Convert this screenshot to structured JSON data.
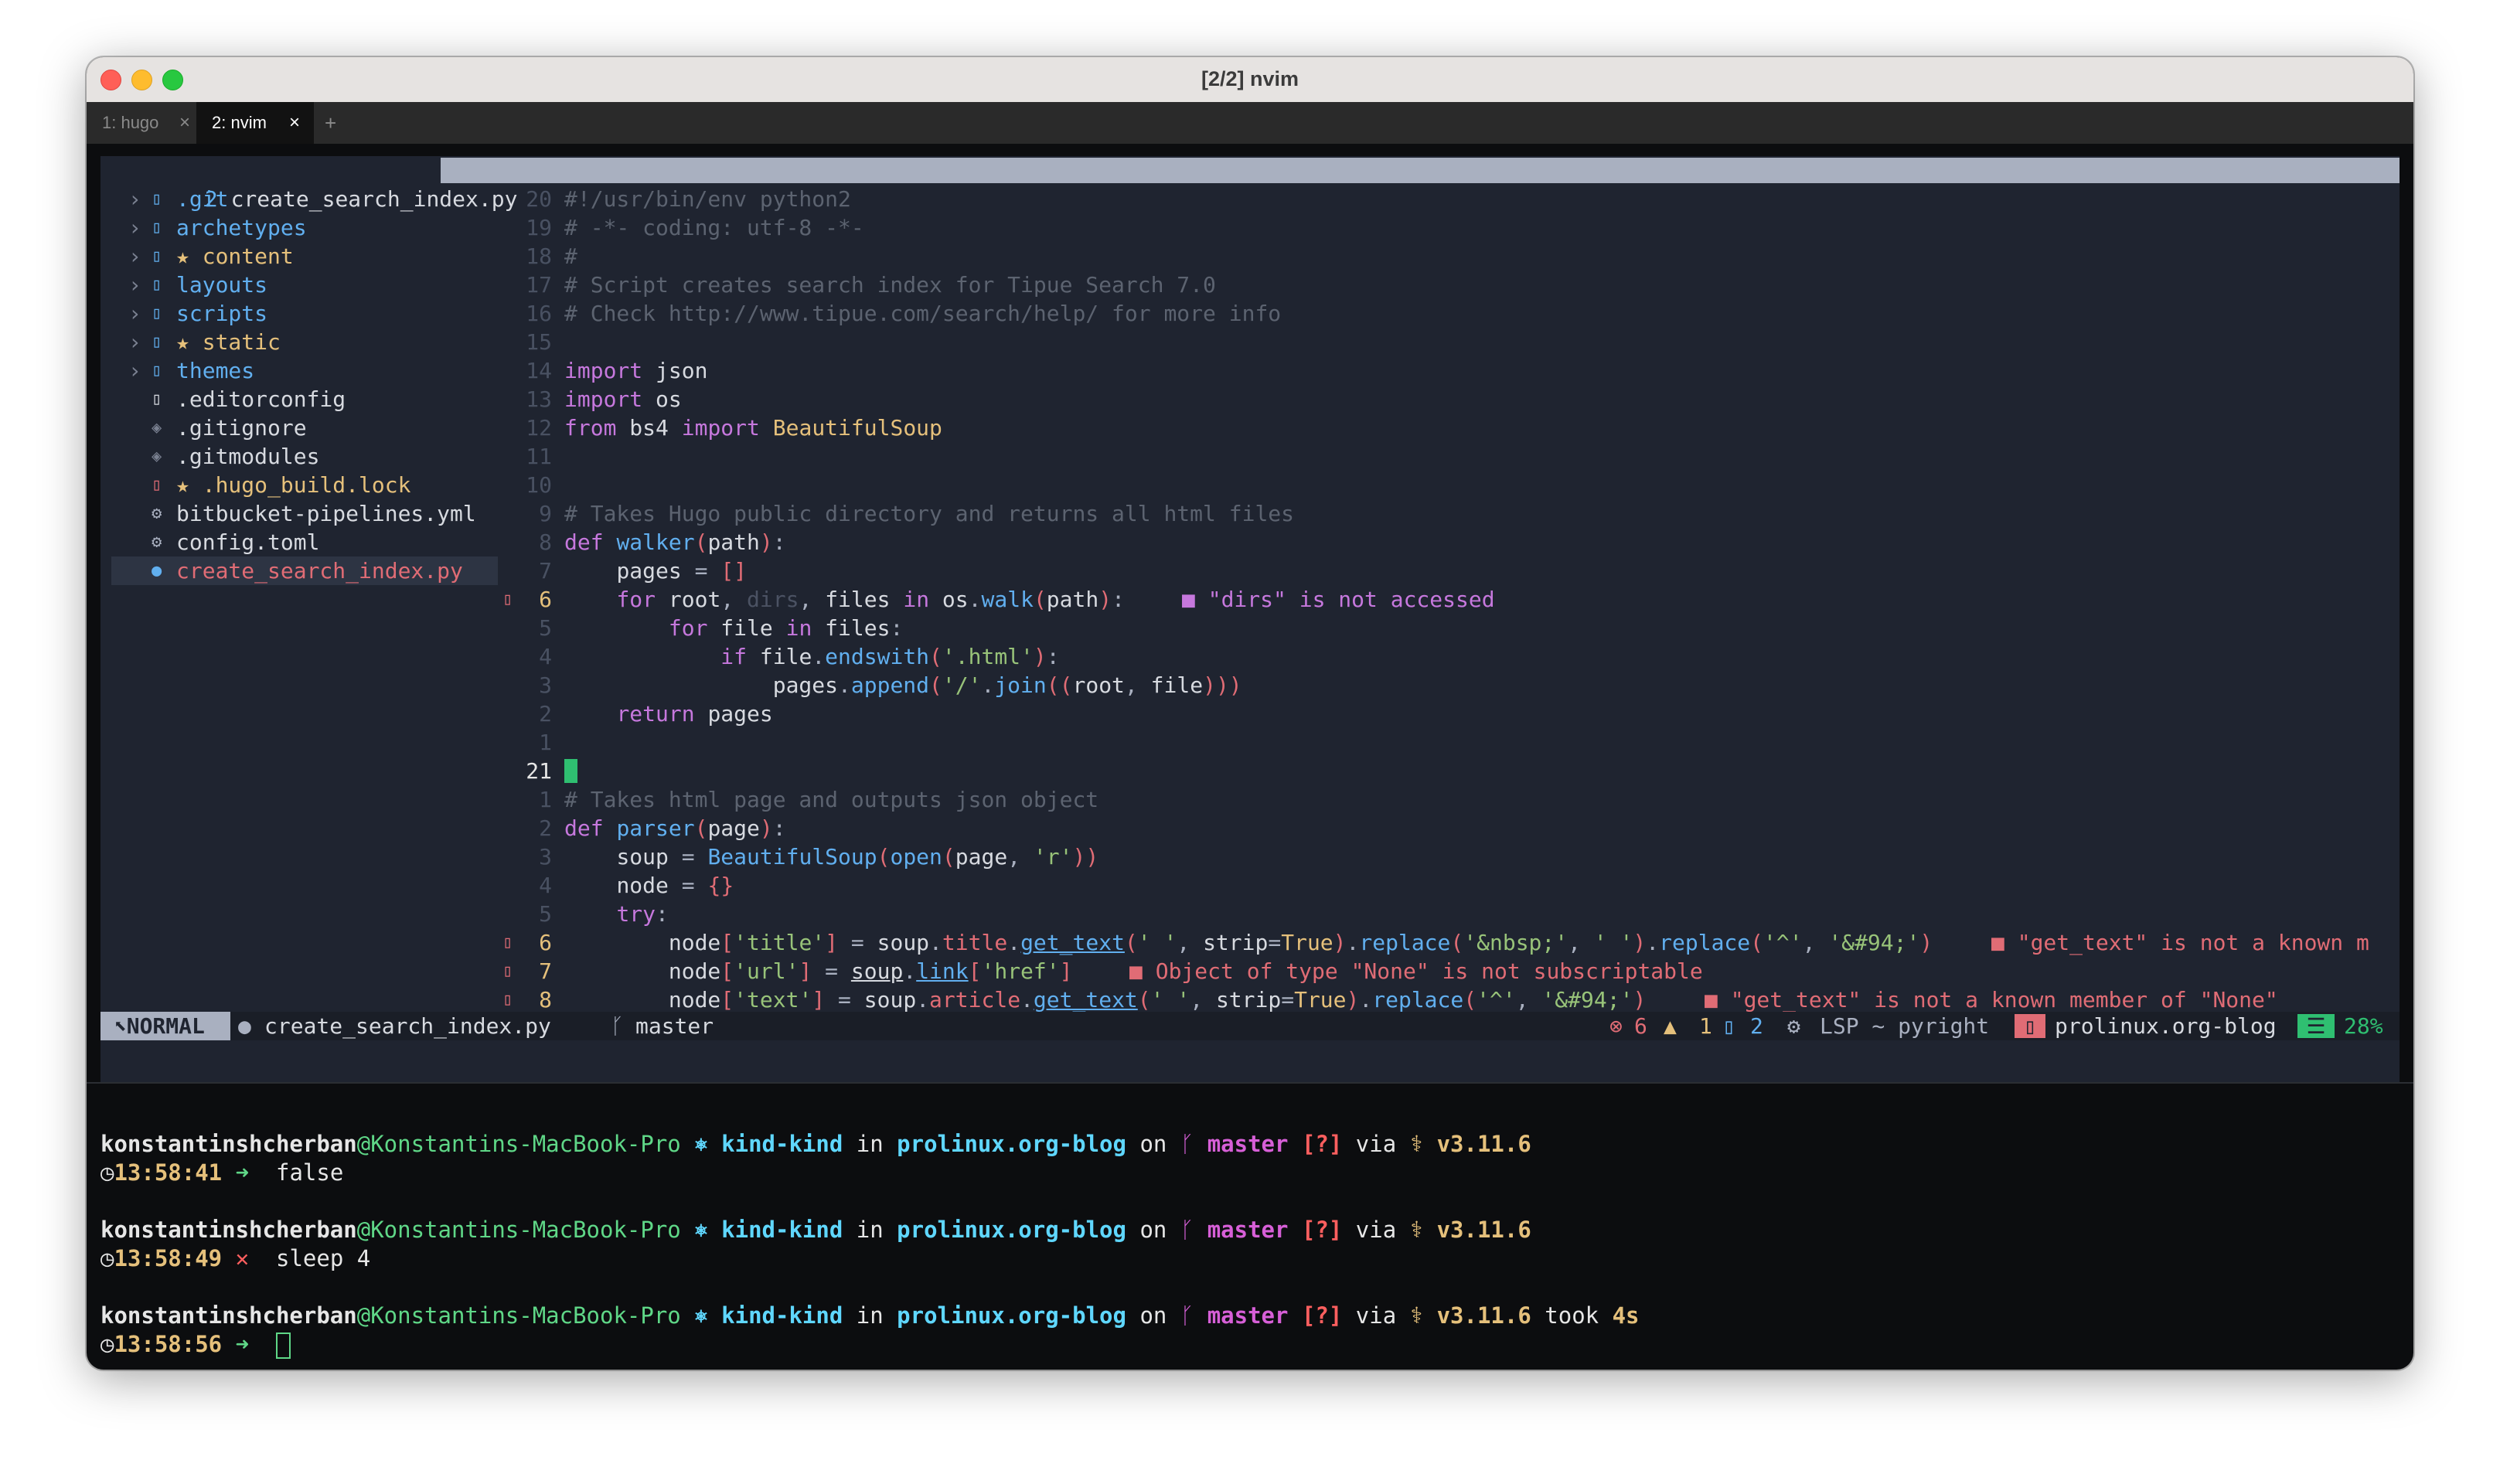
{
  "window": {
    "title": "[2/2] nvim",
    "tabs": [
      {
        "label": "1: hugo",
        "close": "×"
      },
      {
        "label": "2: nvim",
        "close": "×"
      }
    ],
    "new_tab": "+"
  },
  "colors": {
    "red_light": "#ff5f57",
    "yellow_light": "#febc2e",
    "green_light": "#28c840",
    "editor_bg": "#1f2430",
    "keyword": "#c678dd",
    "function": "#61afef",
    "string": "#98c379",
    "comment": "#5c6370",
    "error": "#e06c75",
    "warning": "#e5c07b",
    "gutter": "#495162",
    "accent_green": "#2fbf71"
  },
  "header": {
    "buffer_number": "2",
    "filename": "create_search_index.py"
  },
  "file_tree": [
    {
      "chevron": "›",
      "icon": "▯",
      "name": ".git"
    },
    {
      "chevron": "›",
      "icon": "▯",
      "name": "archetypes"
    },
    {
      "chevron": "›",
      "icon": "▯",
      "name": "★ content"
    },
    {
      "chevron": "›",
      "icon": "▯",
      "name": "layouts"
    },
    {
      "chevron": "›",
      "icon": "▯",
      "name": "scripts"
    },
    {
      "chevron": "›",
      "icon": "▯",
      "name": "★ static"
    },
    {
      "chevron": "›",
      "icon": "▯",
      "name": "themes"
    },
    {
      "chevron": "",
      "icon": "▯",
      "name": ".editorconfig"
    },
    {
      "chevron": "",
      "icon": "◈",
      "name": ".gitignore"
    },
    {
      "chevron": "",
      "icon": "◈",
      "name": ".gitmodules"
    },
    {
      "chevron": "",
      "icon": "▯",
      "name": "★ .hugo_build.lock"
    },
    {
      "chevron": "",
      "icon": "⚙",
      "name": "bitbucket-pipelines.yml"
    },
    {
      "chevron": "",
      "icon": "⚙",
      "name": "config.toml"
    },
    {
      "chevron": "",
      "icon": "●",
      "name": "create_search_index.py"
    }
  ],
  "code": {
    "lines": [
      {
        "num": "20",
        "sign": "",
        "text": "#!/usr/bin/env python2"
      },
      {
        "num": "19",
        "sign": "",
        "text": "# -*- coding: utf-8 -*-"
      },
      {
        "num": "18",
        "sign": "",
        "text": "#"
      },
      {
        "num": "17",
        "sign": "",
        "text": "# Script creates search index for Tipue Search 7.0"
      },
      {
        "num": "16",
        "sign": "",
        "text": "# Check http://www.tipue.com/search/help/ for more info"
      },
      {
        "num": "15",
        "sign": "",
        "text": ""
      },
      {
        "num": "14",
        "sign": "",
        "text": "import json"
      },
      {
        "num": "13",
        "sign": "",
        "text": "import os"
      },
      {
        "num": "12",
        "sign": "",
        "text": "from bs4 import BeautifulSoup"
      },
      {
        "num": "11",
        "sign": "",
        "text": ""
      },
      {
        "num": "10",
        "sign": "",
        "text": ""
      },
      {
        "num": "9",
        "sign": "",
        "text": "# Takes Hugo public directory and returns all html files"
      },
      {
        "num": "8",
        "sign": "",
        "text": "def walker(path):"
      },
      {
        "num": "7",
        "sign": "",
        "text": "    pages = []"
      },
      {
        "num": "6",
        "sign": "▯",
        "text": "    for root, dirs, files in os.walk(path):",
        "diag": "■ \"dirs\" is not accessed"
      },
      {
        "num": "5",
        "sign": "",
        "text": "        for file in files:"
      },
      {
        "num": "4",
        "sign": "",
        "text": "            if file.endswith('.html'):"
      },
      {
        "num": "3",
        "sign": "",
        "text": "                pages.append('/'.join((root, file)))"
      },
      {
        "num": "2",
        "sign": "",
        "text": "    return pages"
      },
      {
        "num": "1",
        "sign": "",
        "text": ""
      },
      {
        "num": "21",
        "sign": "",
        "text": ""
      },
      {
        "num": "1",
        "sign": "",
        "text": "# Takes html page and outputs json object"
      },
      {
        "num": "2",
        "sign": "",
        "text": "def parser(page):"
      },
      {
        "num": "3",
        "sign": "",
        "text": "    soup = BeautifulSoup(open(page, 'r'))"
      },
      {
        "num": "4",
        "sign": "",
        "text": "    node = {}"
      },
      {
        "num": "5",
        "sign": "",
        "text": "    try:"
      },
      {
        "num": "6",
        "sign": "▯",
        "text": "        node['title'] = soup.title.get_text(' ', strip=True).replace('&nbsp;', ' ').replace('^', '&#94;')",
        "diag": "■ \"get_text\" is not a known m"
      },
      {
        "num": "7",
        "sign": "▯",
        "text": "        node['url'] = soup.link['href']",
        "diag": "■ Object of type \"None\" is not subscriptable"
      },
      {
        "num": "8",
        "sign": "▯",
        "text": "        node['text'] = soup.article.get_text(' ', strip=True).replace('^', '&#94;')",
        "diag": "■ \"get_text\" is not a known member of \"None\""
      }
    ]
  },
  "statusline": {
    "mode": "NORMAL",
    "file": "create_search_index.py",
    "branch": "master",
    "errors": "6",
    "warnings": "1",
    "hints": "2",
    "lsp": "LSP ~ pyright",
    "project": "prolinux.org-blog",
    "percent": "28%"
  },
  "terminal": {
    "prompts": [
      {
        "user": "konstantinshcherban",
        "host": "@Konstantins-MacBook-Pro",
        "k8s": "⎈ kind-kind",
        "dir": "prolinux.org-blog",
        "branch": "master",
        "git_status": "[?]",
        "py": "v3.11.6",
        "took": "",
        "time": "13:58:41",
        "arrow": "➜",
        "cmd": "false"
      },
      {
        "user": "konstantinshcherban",
        "host": "@Konstantins-MacBook-Pro",
        "k8s": "⎈ kind-kind",
        "dir": "prolinux.org-blog",
        "branch": "master",
        "git_status": "[?]",
        "py": "v3.11.6",
        "took": "",
        "time": "13:58:49",
        "arrow": "✕",
        "cmd": "sleep 4"
      },
      {
        "user": "konstantinshcherban",
        "host": "@Konstantins-MacBook-Pro",
        "k8s": "⎈ kind-kind",
        "dir": "prolinux.org-blog",
        "branch": "master",
        "git_status": "[?]",
        "py": "v3.11.6",
        "took": "4s",
        "time": "13:58:56",
        "arrow": "➜",
        "cmd": ""
      }
    ],
    "words": {
      "in": "in",
      "on": "on",
      "via": "via",
      "took": "took"
    }
  }
}
